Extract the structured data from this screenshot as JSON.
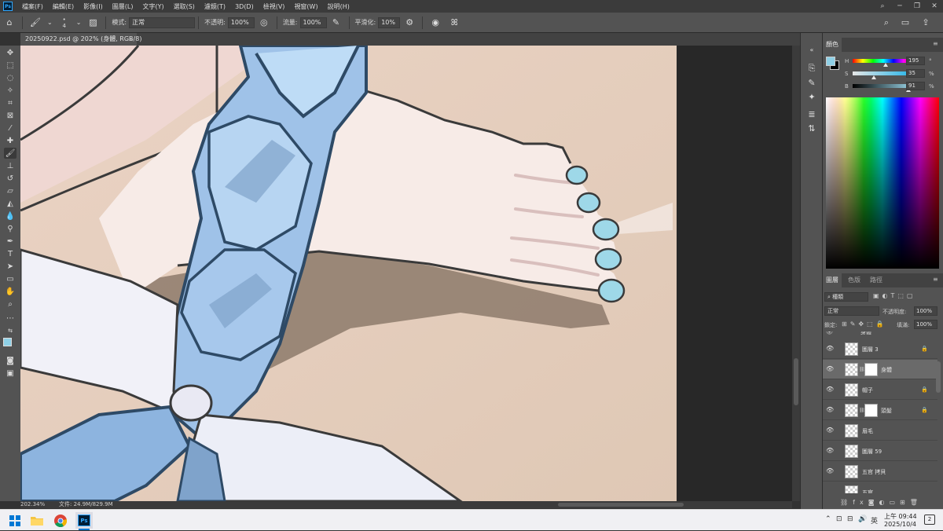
{
  "app": {
    "logo": "Ps",
    "menu": [
      "檔案(F)",
      "編輯(E)",
      "影像(I)",
      "圖層(L)",
      "文字(Y)",
      "選取(S)",
      "濾鏡(T)",
      "3D(D)",
      "檢視(V)",
      "視窗(W)",
      "說明(H)"
    ],
    "window_controls": [
      "search-icon",
      "minimize-icon",
      "restore-icon",
      "close-icon"
    ]
  },
  "options_bar": {
    "brush_size": "4",
    "mode_label": "模式:",
    "mode_value": "正常",
    "opacity_label": "不透明:",
    "opacity_value": "100%",
    "flow_label": "流量:",
    "flow_value": "100%",
    "smoothing_label": "平滑化:",
    "smoothing_value": "10%"
  },
  "document": {
    "tab_title": "20250922.psd @ 202% (身體, RGB/8)",
    "close_glyph": "×",
    "zoom": "202.34%",
    "doc_size": "文件: 24.9M/829.9M"
  },
  "color_panel": {
    "tab": "顏色",
    "h_label": "H",
    "h_value": "195",
    "h_unit": "°",
    "h_level": 0.54,
    "s_label": "S",
    "s_value": "35",
    "s_unit": "%",
    "s_level": 0.35,
    "b_label": "B",
    "b_value": "91",
    "b_unit": "%",
    "b_level": 0.91,
    "foreground": "#8fd0e6",
    "background": "#000000"
  },
  "layers_panel": {
    "tabs": [
      "圖層",
      "色版",
      "路徑"
    ],
    "filter_label": "種類",
    "blend_mode": "正常",
    "opacity_label": "不透明度:",
    "opacity_value": "100%",
    "lock_label": "鎖定:",
    "fill_label": "填滿:",
    "fill_value": "100%",
    "group_name": "身體",
    "layers": [
      {
        "name": "圖層 3",
        "locked": true,
        "mask": false,
        "selected": false,
        "visible": true
      },
      {
        "name": "身體",
        "locked": false,
        "mask": true,
        "selected": true,
        "visible": true
      },
      {
        "name": "帽子",
        "locked": true,
        "mask": false,
        "selected": false,
        "visible": true
      },
      {
        "name": "頭髮",
        "locked": true,
        "mask": true,
        "selected": false,
        "visible": true
      },
      {
        "name": "眉毛",
        "locked": false,
        "mask": false,
        "selected": false,
        "visible": true
      },
      {
        "name": "圖層 59",
        "locked": false,
        "mask": false,
        "selected": false,
        "visible": true
      },
      {
        "name": "五官 拷貝",
        "locked": false,
        "mask": false,
        "selected": false,
        "visible": true
      },
      {
        "name": "五官",
        "locked": false,
        "mask": false,
        "selected": false,
        "visible": false
      }
    ]
  },
  "taskbar": {
    "apps": [
      "windows-start-icon",
      "file-explorer-icon",
      "chrome-icon",
      "photoshop-icon"
    ],
    "ime": "英",
    "time": "上午 09:44",
    "date": "2025/10/4",
    "notification_count": "2"
  }
}
